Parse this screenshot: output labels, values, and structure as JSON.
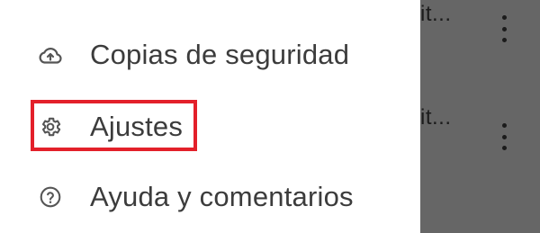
{
  "background": {
    "rows": [
      {
        "text": "it..."
      },
      {
        "text": "it..."
      }
    ]
  },
  "drawer": {
    "items": [
      {
        "label": "Copias de seguridad",
        "icon": "cloud-upload-icon"
      },
      {
        "label": "Ajustes",
        "icon": "gear-icon"
      },
      {
        "label": "Ayuda y comentarios",
        "icon": "help-circle-icon"
      }
    ]
  },
  "colors": {
    "highlight": "#e3202a",
    "scrim": "#666666",
    "text": "#3c3c3c"
  }
}
